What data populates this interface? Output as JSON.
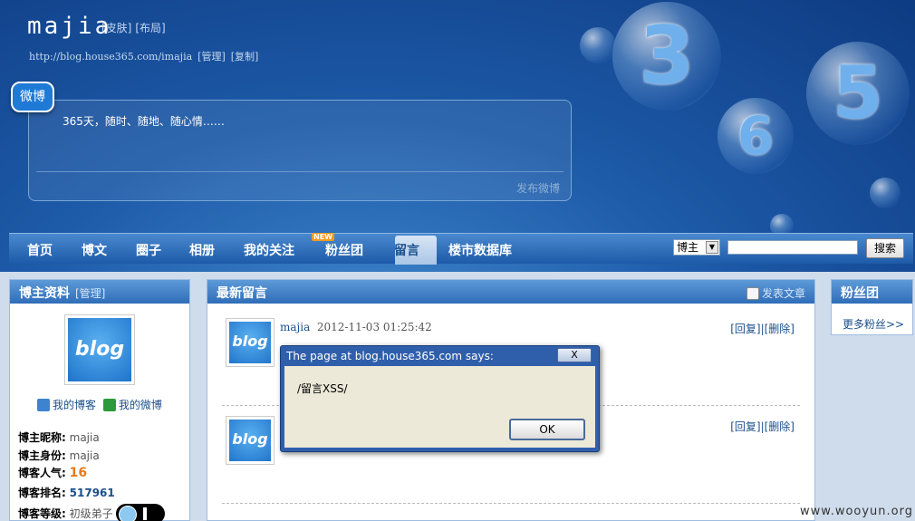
{
  "header": {
    "title": "majia",
    "skin_link": "[皮肤]",
    "layout_link": "[布局]",
    "url": "http://blog.house365.com/imajia",
    "manage_link": "[管理]",
    "copy_link": "[复制]"
  },
  "weibo": {
    "icon_label": "微博",
    "text": "365天，随时、随地、随心情……",
    "post_button": "发布微博"
  },
  "bubbles": [
    "3",
    "6",
    "5"
  ],
  "nav": {
    "items": [
      "首页",
      "博文",
      "圈子",
      "相册",
      "我的关注",
      "粉丝团",
      "留言",
      "楼市数据库"
    ],
    "new_badge": "NEW",
    "active": "留言",
    "search_select": "博主",
    "search_button": "搜索"
  },
  "left_panel": {
    "title": "博主资料",
    "manage": "[管理]",
    "logo_text": "blog",
    "my_blog": "我的博客",
    "my_weibo": "我的微博",
    "nickname_label": "博主昵称:",
    "nickname": "majia",
    "identity_label": "博主身份:",
    "identity": "majia",
    "popularity_label": "博客人气:",
    "popularity": "16",
    "rank_label": "博客排名:",
    "rank": "517961",
    "level_label": "博客等级:",
    "level": "初级弟子"
  },
  "mid_panel": {
    "title": "最新留言",
    "post_article": "发表文章",
    "messages": [
      {
        "user": "majia",
        "time": "2012-11-03 01:25:42",
        "reply": "[回复]",
        "delete": "[删除]"
      },
      {
        "user": "",
        "time": "",
        "reply": "[回复]",
        "delete": "[删除]"
      }
    ]
  },
  "right_panel": {
    "title": "粉丝团",
    "more": "更多粉丝>>"
  },
  "alert": {
    "title": "The page at blog.house365.com says:",
    "close": "X",
    "message": "/留言XSS/",
    "ok": "OK"
  },
  "watermark": "www.wooyun.org"
}
